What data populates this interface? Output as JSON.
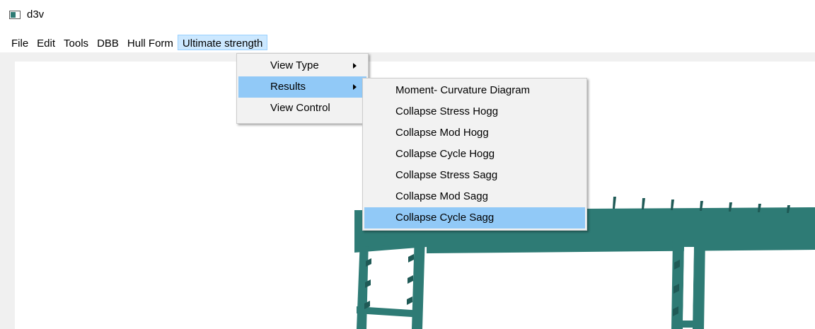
{
  "window": {
    "title": "d3v"
  },
  "menubar": {
    "items": [
      "File",
      "Edit",
      "Tools",
      "DBB",
      "Hull Form",
      "Ultimate strength"
    ],
    "active_index": 5
  },
  "ultimate_menu": {
    "items": [
      {
        "label": "View Type",
        "has_submenu": true
      },
      {
        "label": "Results",
        "has_submenu": true,
        "selected": true
      },
      {
        "label": "View Control",
        "has_submenu": false
      }
    ]
  },
  "results_menu": {
    "items": [
      "Moment- Curvature Diagram",
      "Collapse Stress Hogg",
      "Collapse Mod Hogg",
      "Collapse Cycle Hogg",
      "Collapse Stress Sagg",
      "Collapse Mod Sagg",
      "Collapse Cycle Sagg"
    ],
    "selected_index": 6
  },
  "colors": {
    "model": "#2e7b75",
    "model_edge": "#1f5a56",
    "menu_highlight": "#91c9f7",
    "menubar_active": "#cce8ff"
  }
}
